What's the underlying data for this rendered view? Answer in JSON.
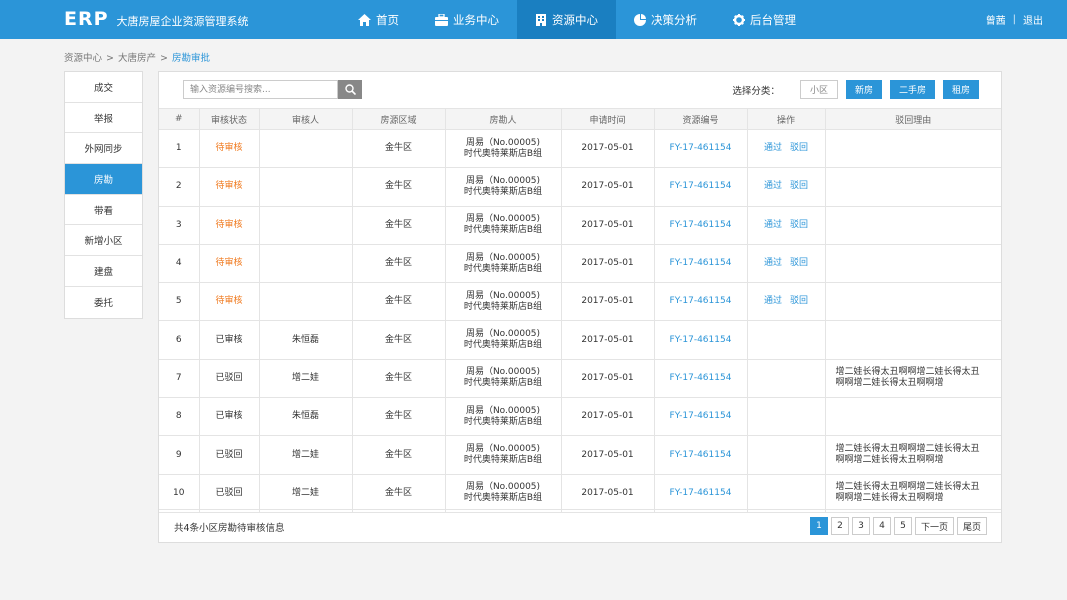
{
  "brand": {
    "logo": "ERP",
    "system_name": "大唐房屋企业资源管理系统"
  },
  "nav": [
    {
      "label": "首页",
      "icon": "home-icon"
    },
    {
      "label": "业务中心",
      "icon": "briefcase-icon"
    },
    {
      "label": "资源中心",
      "icon": "building-icon",
      "active": true
    },
    {
      "label": "决策分析",
      "icon": "pie-chart-icon"
    },
    {
      "label": "后台管理",
      "icon": "gear-icon"
    }
  ],
  "user": {
    "name": "曾茜",
    "logout": "退出"
  },
  "breadcrumb": {
    "level1": "资源中心",
    "level2": "大唐房产",
    "current": "房勘审批"
  },
  "sidebar": [
    {
      "label": "成交"
    },
    {
      "label": "举报"
    },
    {
      "label": "外网同步"
    },
    {
      "label": "房勘",
      "active": true
    },
    {
      "label": "带看"
    },
    {
      "label": "新增小区"
    },
    {
      "label": "建盘"
    },
    {
      "label": "委托"
    }
  ],
  "search": {
    "placeholder": "输入资源编号搜索..."
  },
  "filter": {
    "label": "选择分类：",
    "chips": [
      "小区",
      "新房",
      "二手房",
      "租房"
    ]
  },
  "table": {
    "headers": [
      "#",
      "审核状态",
      "审核人",
      "房源区域",
      "房勘人",
      "申请时间",
      "资源编号",
      "操作",
      "驳回理由"
    ],
    "rows": [
      {
        "no": "1",
        "status": "待审核",
        "reviewer": "",
        "area": "金牛区",
        "agent1": "周易（No.00005)",
        "agent2": "时代奥特莱斯店B组",
        "date": "2017-05-01",
        "code": "FY-17-461154",
        "op1": "通过",
        "op2": "驳回",
        "reason1": "",
        "reason2": ""
      },
      {
        "no": "2",
        "status": "待审核",
        "reviewer": "",
        "area": "金牛区",
        "agent1": "周易（No.00005)",
        "agent2": "时代奥特莱斯店B组",
        "date": "2017-05-01",
        "code": "FY-17-461154",
        "op1": "通过",
        "op2": "驳回",
        "reason1": "",
        "reason2": ""
      },
      {
        "no": "3",
        "status": "待审核",
        "reviewer": "",
        "area": "金牛区",
        "agent1": "周易（No.00005)",
        "agent2": "时代奥特莱斯店B组",
        "date": "2017-05-01",
        "code": "FY-17-461154",
        "op1": "通过",
        "op2": "驳回",
        "reason1": "",
        "reason2": ""
      },
      {
        "no": "4",
        "status": "待审核",
        "reviewer": "",
        "area": "金牛区",
        "agent1": "周易（No.00005)",
        "agent2": "时代奥特莱斯店B组",
        "date": "2017-05-01",
        "code": "FY-17-461154",
        "op1": "通过",
        "op2": "驳回",
        "reason1": "",
        "reason2": ""
      },
      {
        "no": "5",
        "status": "待审核",
        "reviewer": "",
        "area": "金牛区",
        "agent1": "周易（No.00005)",
        "agent2": "时代奥特莱斯店B组",
        "date": "2017-05-01",
        "code": "FY-17-461154",
        "op1": "通过",
        "op2": "驳回",
        "reason1": "",
        "reason2": ""
      },
      {
        "no": "6",
        "status": "已审核",
        "reviewer": "朱恒磊",
        "area": "金牛区",
        "agent1": "周易（No.00005)",
        "agent2": "时代奥特莱斯店B组",
        "date": "2017-05-01",
        "code": "FY-17-461154",
        "op1": "",
        "op2": "",
        "reason1": "",
        "reason2": ""
      },
      {
        "no": "7",
        "status": "已驳回",
        "reviewer": "增二娃",
        "area": "金牛区",
        "agent1": "周易（No.00005)",
        "agent2": "时代奥特莱斯店B组",
        "date": "2017-05-01",
        "code": "FY-17-461154",
        "op1": "",
        "op2": "",
        "reason1": "增二娃长得太丑啊啊增二娃长得太丑",
        "reason2": "啊啊增二娃长得太丑啊啊增"
      },
      {
        "no": "8",
        "status": "已审核",
        "reviewer": "朱恒磊",
        "area": "金牛区",
        "agent1": "周易（No.00005)",
        "agent2": "时代奥特莱斯店B组",
        "date": "2017-05-01",
        "code": "FY-17-461154",
        "op1": "",
        "op2": "",
        "reason1": "",
        "reason2": ""
      },
      {
        "no": "9",
        "status": "已驳回",
        "reviewer": "增二娃",
        "area": "金牛区",
        "agent1": "周易（No.00005)",
        "agent2": "时代奥特莱斯店B组",
        "date": "2017-05-01",
        "code": "FY-17-461154",
        "op1": "",
        "op2": "",
        "reason1": "增二娃长得太丑啊啊增二娃长得太丑",
        "reason2": "啊啊增二娃长得太丑啊啊增"
      },
      {
        "no": "10",
        "status": "已驳回",
        "reviewer": "增二娃",
        "area": "金牛区",
        "agent1": "周易（No.00005)",
        "agent2": "时代奥特莱斯店B组",
        "date": "2017-05-01",
        "code": "FY-17-461154",
        "op1": "",
        "op2": "",
        "reason1": "增二娃长得太丑啊啊增二娃长得太丑",
        "reason2": "啊啊增二娃长得太丑啊啊增"
      }
    ]
  },
  "footer": {
    "summary": "共4条小区房勘待审核信息"
  },
  "pager": {
    "pages": [
      "1",
      "2",
      "3",
      "4",
      "5"
    ],
    "current": "1",
    "next": "下一页",
    "last": "尾页"
  },
  "colors": {
    "primary": "#2b95d8",
    "active_nav": "#1a7fc1",
    "pending": "#f07a1f"
  }
}
